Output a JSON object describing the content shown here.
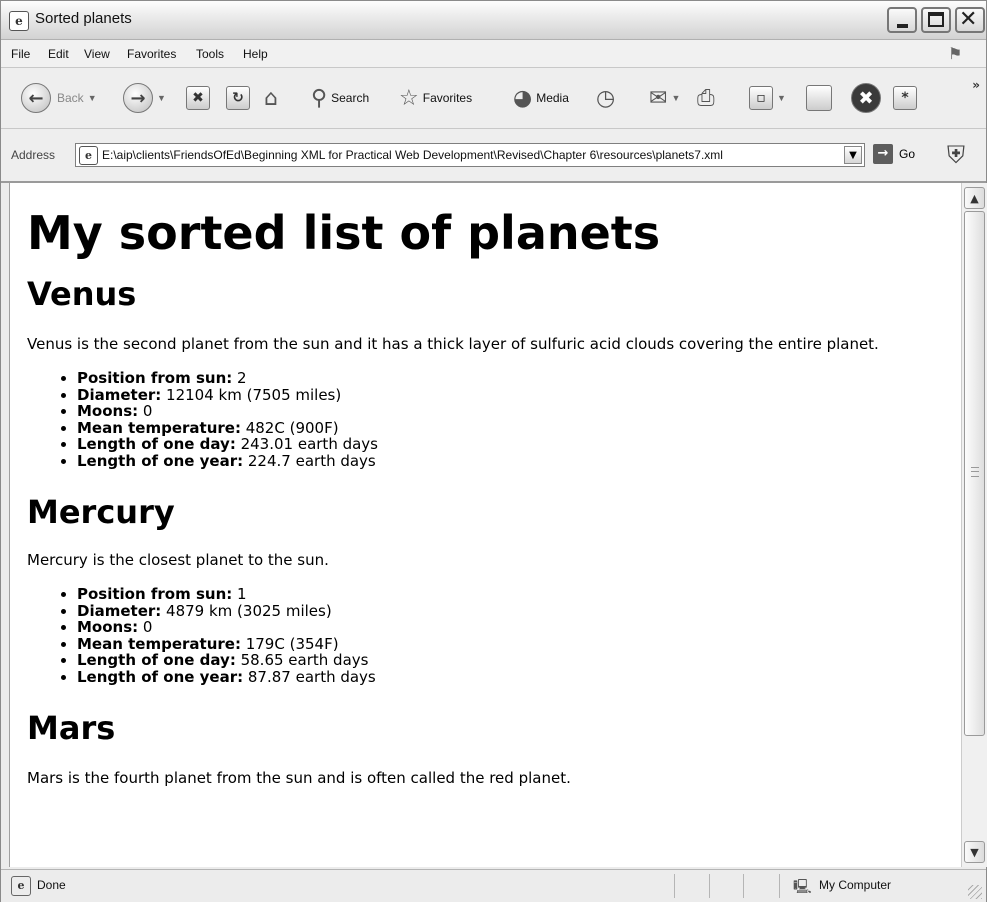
{
  "window": {
    "title": "Sorted planets"
  },
  "menu": [
    "File",
    "Edit",
    "View",
    "Favorites",
    "Tools",
    "Help"
  ],
  "toolbar": {
    "back_label": "Back",
    "search_label": "Search",
    "favorites_label": "Favorites",
    "media_label": "Media"
  },
  "address": {
    "label": "Address",
    "value": "E:\\aip\\clients\\FriendsOfEd\\Beginning XML for Practical Web Development\\Revised\\Chapter 6\\resources\\planets7.xml",
    "go_label": "Go"
  },
  "page": {
    "heading": "My sorted list of planets",
    "planets": [
      {
        "name": "Venus",
        "description": "Venus is the second planet from the sun and it has a thick layer of sulfuric acid clouds covering the entire planet.",
        "facts": [
          {
            "label": "Position from sun:",
            "value": " 2"
          },
          {
            "label": "Diameter:",
            "value": " 12104 km (7505 miles)"
          },
          {
            "label": "Moons:",
            "value": " 0"
          },
          {
            "label": "Mean temperature:",
            "value": " 482C (900F)"
          },
          {
            "label": "Length of one day:",
            "value": " 243.01 earth days"
          },
          {
            "label": "Length of one year:",
            "value": " 224.7 earth days"
          }
        ]
      },
      {
        "name": "Mercury",
        "description": "Mercury is the closest planet to the sun.",
        "facts": [
          {
            "label": "Position from sun:",
            "value": " 1"
          },
          {
            "label": "Diameter:",
            "value": " 4879 km (3025 miles)"
          },
          {
            "label": "Moons:",
            "value": " 0"
          },
          {
            "label": "Mean temperature:",
            "value": " 179C (354F)"
          },
          {
            "label": "Length of one day:",
            "value": " 58.65 earth days"
          },
          {
            "label": "Length of one year:",
            "value": " 87.87 earth days"
          }
        ]
      },
      {
        "name": "Mars",
        "description": "Mars is the fourth planet from the sun and is often called the red planet.",
        "facts": []
      }
    ]
  },
  "status": {
    "text": "Done",
    "zone": "My Computer"
  }
}
